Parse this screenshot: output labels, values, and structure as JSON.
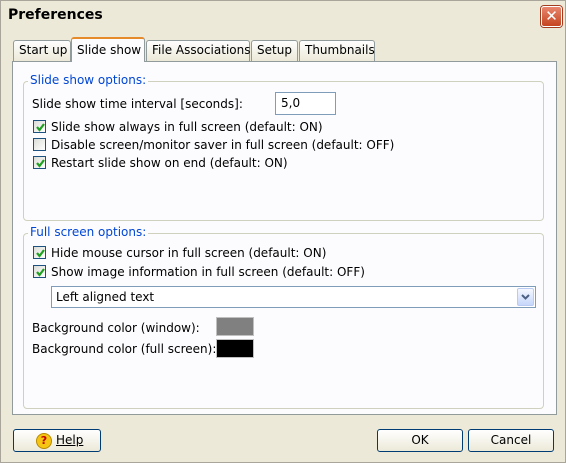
{
  "window": {
    "title": "Preferences"
  },
  "tabs": [
    {
      "label": "Start up"
    },
    {
      "label": "Slide show"
    },
    {
      "label": "File Associations"
    },
    {
      "label": "Setup"
    },
    {
      "label": "Thumbnails"
    }
  ],
  "active_tab": "Slide show",
  "slideshow": {
    "legend": "Slide show options:",
    "interval_label": "Slide show time interval [seconds]:",
    "interval_value": "5,0",
    "options": [
      {
        "label": "Slide show always in full screen (default: ON)",
        "checked": true
      },
      {
        "label": "Disable screen/monitor saver in full screen (default: OFF)",
        "checked": false
      },
      {
        "label": "Restart slide show on end (default: ON)",
        "checked": true
      }
    ]
  },
  "fullscreen": {
    "legend": "Full screen options:",
    "options": [
      {
        "label": "Hide mouse cursor in full screen (default: ON)",
        "checked": true
      },
      {
        "label": "Show image information in full screen (default: OFF)",
        "checked": true
      }
    ],
    "alignment_selected": "Left aligned text",
    "bg_window_label": "Background color (window):",
    "bg_window_color": "#808080",
    "bg_fullscreen_label": "Background color (full screen):",
    "bg_fullscreen_color": "#000000"
  },
  "buttons": {
    "help": "Help",
    "ok": "OK",
    "cancel": "Cancel"
  },
  "colors": {
    "accent_tab": "#e68b2c",
    "legend_blue": "#0046d5",
    "close_red": "#c4441f"
  }
}
